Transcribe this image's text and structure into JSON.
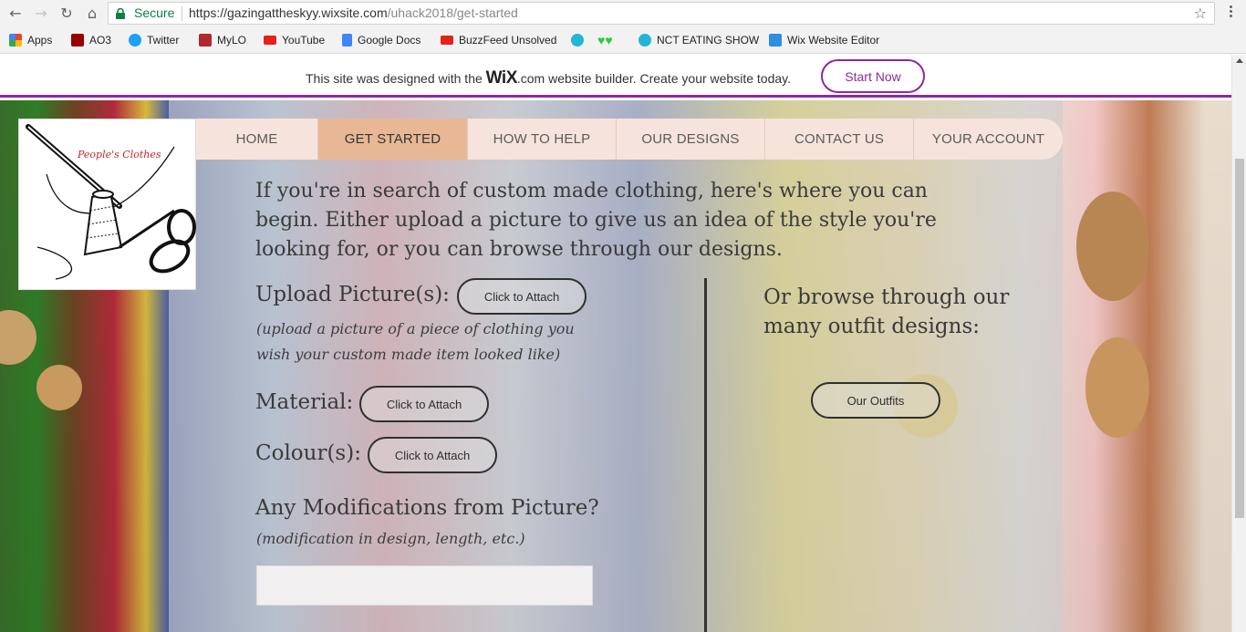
{
  "browser": {
    "secure_label": "Secure",
    "url_host": "https://gazingattheskyy.wixsite.com",
    "url_path": "/uhack2018/get-started",
    "bookmarks": [
      {
        "label": "Apps",
        "icon": "apps-grid-icon",
        "color": "#e94335"
      },
      {
        "label": "AO3",
        "icon": "ao3-icon",
        "color": "#990000"
      },
      {
        "label": "Twitter",
        "icon": "twitter-bird-icon",
        "color": "#1da1f2"
      },
      {
        "label": "MyLO",
        "icon": "mylo-icon",
        "color": "#b3262e"
      },
      {
        "label": "YouTube",
        "icon": "youtube-play-icon",
        "color": "#e62117"
      },
      {
        "label": "Google Docs",
        "icon": "google-docs-icon",
        "color": "#4285f4"
      },
      {
        "label": "BuzzFeed Unsolved",
        "icon": "youtube-play-icon",
        "color": "#e62117"
      },
      {
        "label": "",
        "icon": "bookmark-face-icon",
        "color": "#22b5d4"
      },
      {
        "label": "",
        "icon": "green-hearts-icon",
        "color": "#2ecc40"
      },
      {
        "label": "NCT EATING SHOW",
        "icon": "bookmark-face-icon",
        "color": "#22b5d4"
      },
      {
        "label": "Wix Website Editor",
        "icon": "wix-editor-icon",
        "color": "#2f8ee0"
      }
    ]
  },
  "wix_banner": {
    "text_before": "This site was designed with the",
    "logo_main": "WiX",
    "logo_suffix": ".com",
    "text_after": "website builder. Create your website today.",
    "cta": "Start Now"
  },
  "logo": {
    "text": "People's Clothes"
  },
  "site_nav": {
    "items": [
      {
        "label": "HOME",
        "active": false
      },
      {
        "label": "GET STARTED",
        "active": true
      },
      {
        "label": "HOW TO HELP",
        "active": false
      },
      {
        "label": "OUR DESIGNS",
        "active": false
      },
      {
        "label": "CONTACT US",
        "active": false
      },
      {
        "label": "YOUR ACCOUNT",
        "active": false
      }
    ]
  },
  "main": {
    "intro": "If you're in search of custom made clothing, here's where you can begin. Either upload a picture to give us an idea of the style you're looking for, or you can browse through our designs.",
    "upload_label": "Upload Picture(s):",
    "upload_note": "(upload a picture of a piece of clothing you wish your custom made item looked like)",
    "attach_label": "Click to Attach",
    "material_label": "Material:",
    "colour_label": "Colour(s):",
    "modifications_label": "Any Modifications from Picture?",
    "modifications_note": "(modification in design, length, etc.)",
    "modifications_value": "",
    "browse_label": "Or browse through our many outfit designs:",
    "outfits_button": "Our Outfits"
  }
}
